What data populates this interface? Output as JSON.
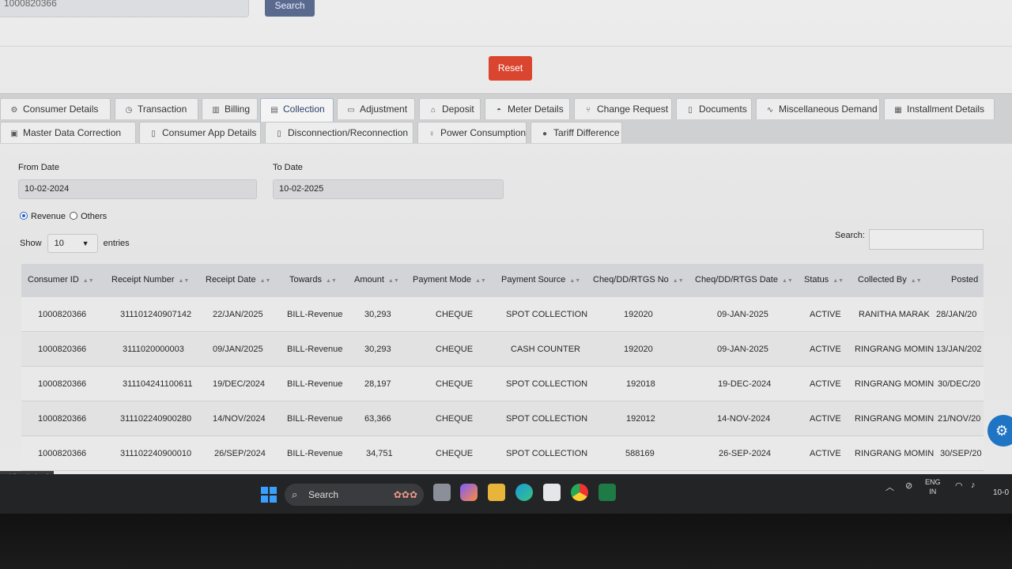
{
  "top": {
    "input_value": "1000820366",
    "search_label": "Search",
    "reset_label": "Reset"
  },
  "tabs_row1": [
    {
      "label": "Consumer Details",
      "icon": "gear-icon"
    },
    {
      "label": "Transaction",
      "icon": "history-icon"
    },
    {
      "label": "Billing",
      "icon": "bar-chart-icon"
    },
    {
      "label": "Collection",
      "icon": "list-icon",
      "active": true
    },
    {
      "label": "Adjustment",
      "icon": "window-icon"
    },
    {
      "label": "Deposit",
      "icon": "bank-icon"
    },
    {
      "label": "Meter Details",
      "icon": "gauge-icon"
    },
    {
      "label": "Change Request",
      "icon": "branch-icon"
    },
    {
      "label": "Documents",
      "icon": "document-icon"
    },
    {
      "label": "Miscellaneous Demand",
      "icon": "pulse-icon"
    },
    {
      "label": "Installment Details",
      "icon": "calculator-icon"
    }
  ],
  "tabs_row2": [
    {
      "label": "Master Data Correction",
      "icon": "image-icon"
    },
    {
      "label": "Consumer App Details",
      "icon": "mobile-icon"
    },
    {
      "label": "Disconnection/Reconnection",
      "icon": "mobile-icon"
    },
    {
      "label": "Power Consumption",
      "icon": "bulb-icon"
    },
    {
      "label": "Tariff Difference",
      "icon": "dot-icon"
    }
  ],
  "filters": {
    "from_label": "From Date",
    "from_value": "10-02-2024",
    "to_label": "To Date",
    "to_value": "10-02-2025",
    "radio_revenue": "Revenue",
    "radio_others": "Others",
    "show_label": "Show",
    "show_value": "10",
    "entries_label": "entries",
    "search_label": "Search:"
  },
  "table": {
    "headers": [
      "Consumer ID",
      "Receipt Number",
      "Receipt Date",
      "Towards",
      "Amount",
      "Payment Mode",
      "Payment Source",
      "Cheq/DD/RTGS No",
      "Cheq/DD/RTGS Date",
      "Status",
      "Collected By",
      "Posted"
    ],
    "rows": [
      [
        "1000820366",
        "311101240907142",
        "22/JAN/2025",
        "BILL-Revenue",
        "30,293",
        "CHEQUE",
        "SPOT COLLECTION",
        "192020",
        "09-JAN-2025",
        "ACTIVE",
        "RANITHA MARAK",
        "28/JAN/20"
      ],
      [
        "1000820366",
        "3111020000003",
        "09/JAN/2025",
        "BILL-Revenue",
        "30,293",
        "CHEQUE",
        "CASH COUNTER",
        "192020",
        "09-JAN-2025",
        "ACTIVE",
        "RINGRANG MOMIN",
        "13/JAN/202"
      ],
      [
        "1000820366",
        "311104241100611",
        "19/DEC/2024",
        "BILL-Revenue",
        "28,197",
        "CHEQUE",
        "SPOT COLLECTION",
        "192018",
        "19-DEC-2024",
        "ACTIVE",
        "RINGRANG MOMIN",
        "30/DEC/20"
      ],
      [
        "1000820366",
        "311102240900280",
        "14/NOV/2024",
        "BILL-Revenue",
        "63,366",
        "CHEQUE",
        "SPOT COLLECTION",
        "192012",
        "14-NOV-2024",
        "ACTIVE",
        "RINGRANG MOMIN",
        "21/NOV/20"
      ],
      [
        "1000820366",
        "311102240900010",
        "26/SEP/2024",
        "BILL-Revenue",
        "34,751",
        "CHEQUE",
        "SPOT COLLECTION",
        "588169",
        "26-SEP-2024",
        "ACTIVE",
        "RINGRANG MOMIN",
        "30/SEP/20"
      ]
    ]
  },
  "status_url": "terView#tabs-4",
  "taskbar": {
    "search_label": "Search",
    "lang_line1": "ENG",
    "lang_line2": "IN",
    "clock": "10-0"
  },
  "colors": {
    "reset": "#d9452f",
    "search_button": "#5a6a8f",
    "gear_fab": "#1f74c4"
  }
}
